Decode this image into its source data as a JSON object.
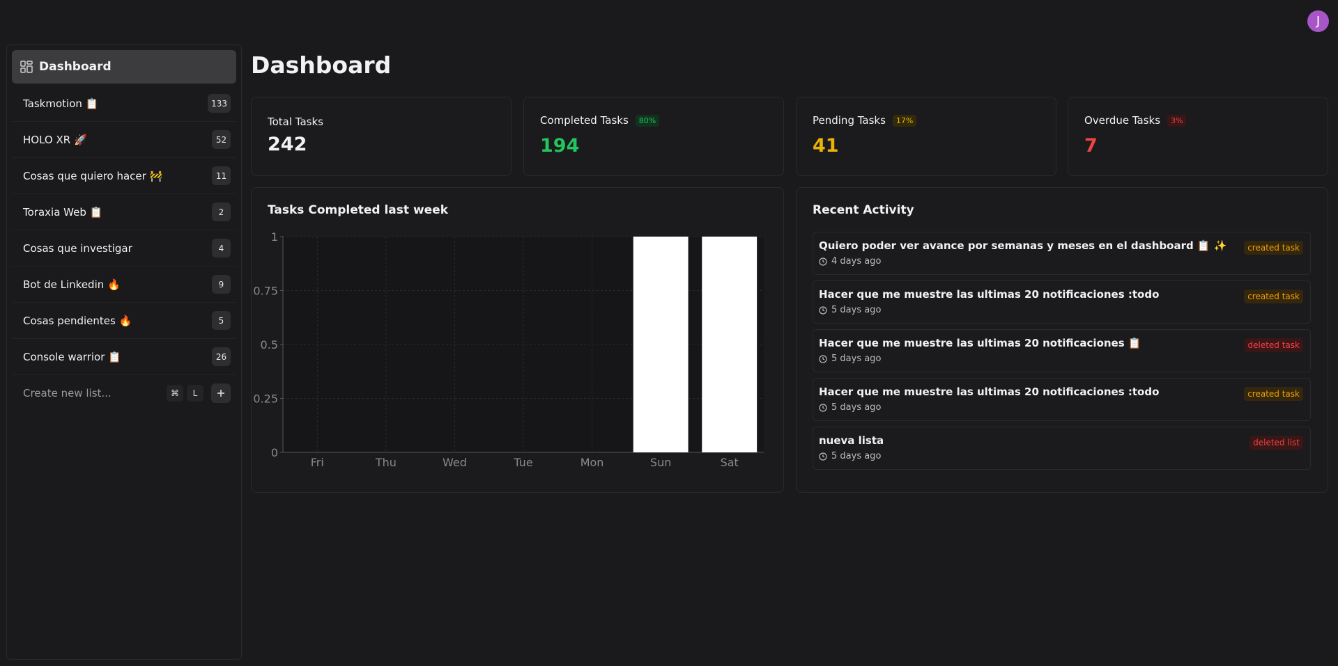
{
  "user": {
    "avatar_initial": "J",
    "avatar_color": "#a855c8"
  },
  "sidebar": {
    "dashboard_label": "Dashboard",
    "dashboard_icon": "grid-icon",
    "items": [
      {
        "label": "Taskmotion 📋",
        "count": "133"
      },
      {
        "label": "HOLO XR 🚀",
        "count": "52"
      },
      {
        "label": "Cosas que quiero hacer 🚧",
        "count": "11"
      },
      {
        "label": "Toraxia Web 📋",
        "count": "2"
      },
      {
        "label": "Cosas que investigar",
        "count": "4"
      },
      {
        "label": "Bot de Linkedin 🔥",
        "count": "9"
      },
      {
        "label": "Cosas pendientes 🔥",
        "count": "5"
      },
      {
        "label": "Console warrior 📋",
        "count": "26"
      }
    ],
    "new_list": {
      "placeholder": "Create new list...",
      "shortcut_mod": "⌘",
      "shortcut_key": "L",
      "add_icon": "plus-icon"
    }
  },
  "page": {
    "title": "Dashboard"
  },
  "stats": [
    {
      "label": "Total Tasks",
      "value": "242",
      "badge": "",
      "color": "#ffffff"
    },
    {
      "label": "Completed Tasks",
      "value": "194",
      "badge": "80%",
      "color": "#22c55e",
      "badge_bg": "#11321d"
    },
    {
      "label": "Pending Tasks",
      "value": "41",
      "badge": "17%",
      "color": "#eab308",
      "badge_bg": "#33290b"
    },
    {
      "label": "Overdue Tasks",
      "value": "7",
      "badge": "3%",
      "color": "#ef4444",
      "badge_bg": "#3a1616"
    }
  ],
  "chart_title": "Tasks Completed last week",
  "chart_data": {
    "type": "bar",
    "title": "Tasks Completed last week",
    "categories": [
      "Fri",
      "Thu",
      "Wed",
      "Tue",
      "Mon",
      "Sun",
      "Sat"
    ],
    "values": [
      0,
      0,
      0,
      0,
      0,
      1,
      1
    ],
    "yticks": [
      "0",
      "0.25",
      "0.5",
      "0.75",
      "1"
    ],
    "ylim": [
      0,
      1
    ],
    "grid": true,
    "bar_color": "#ffffff"
  },
  "activity": {
    "title": "Recent Activity",
    "clock_icon": "clock-icon",
    "items": [
      {
        "title": "Quiero poder ver avance por semanas y meses en el dashboard 📋 ✨",
        "time": "4 days ago",
        "tag": "created task",
        "tag_color": "#f59e0b",
        "tag_bg": "#33270d"
      },
      {
        "title": "Hacer que me muestre las ultimas 20 notificaciones :todo",
        "time": "5 days ago",
        "tag": "created task",
        "tag_color": "#f59e0b",
        "tag_bg": "#33270d"
      },
      {
        "title": "Hacer que me muestre las ultimas 20 notificaciones 📋",
        "time": "5 days ago",
        "tag": "deleted task",
        "tag_color": "#ef4444",
        "tag_bg": "#3a1616"
      },
      {
        "title": "Hacer que me muestre las ultimas 20 notificaciones :todo",
        "time": "5 days ago",
        "tag": "created task",
        "tag_color": "#f59e0b",
        "tag_bg": "#33270d"
      },
      {
        "title": "nueva lista",
        "time": "5 days ago",
        "tag": "deleted list",
        "tag_color": "#ef4444",
        "tag_bg": "#3a1616"
      }
    ]
  }
}
